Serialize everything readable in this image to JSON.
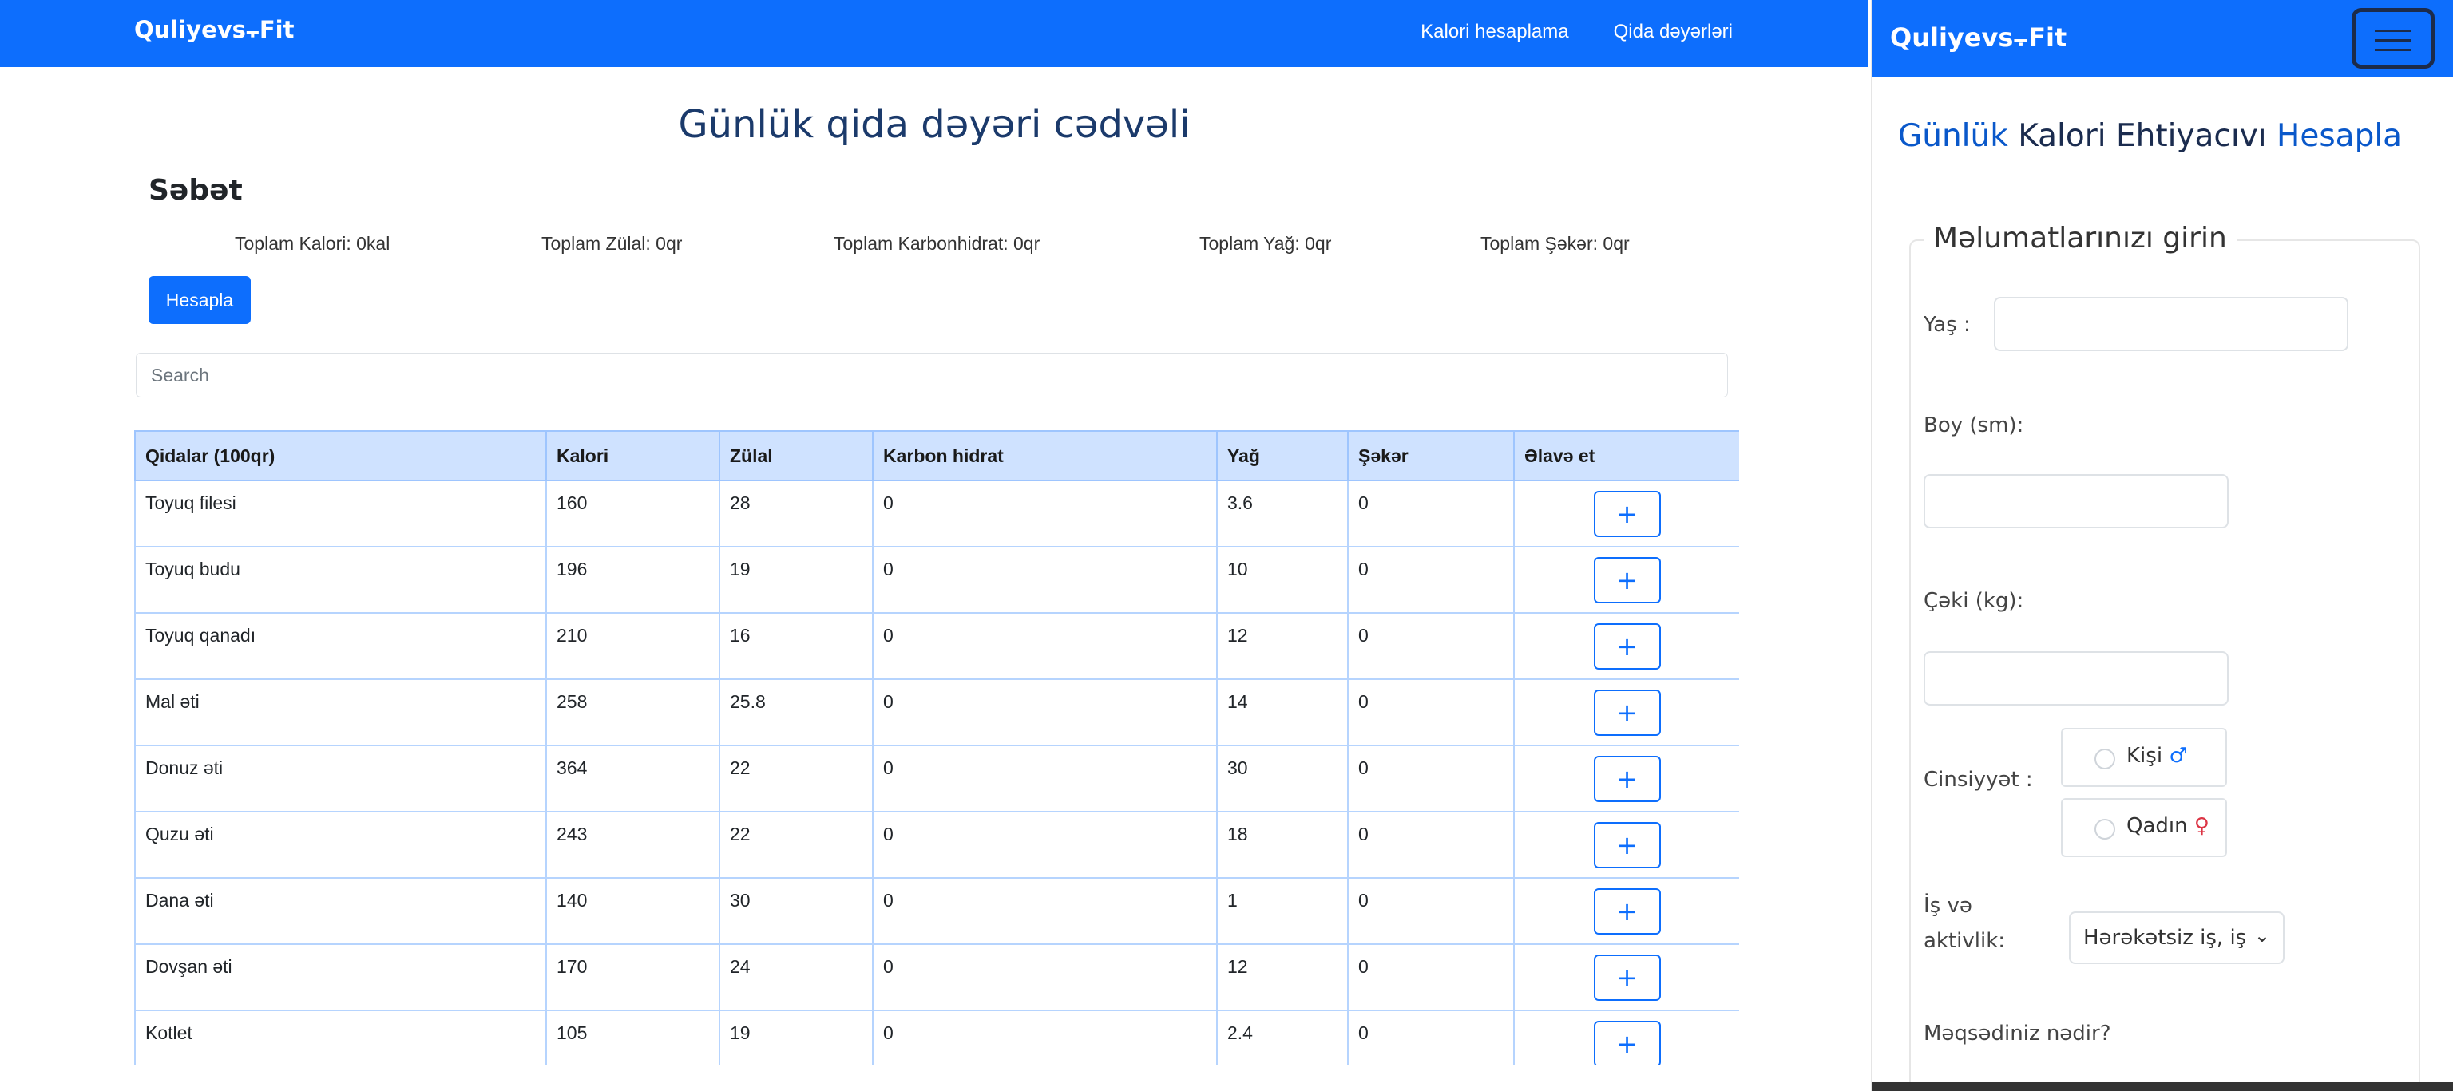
{
  "brand": "Quliyevs⨪Fit",
  "nav_links": [
    "Kalori hesaplama",
    "Qida dəyərləri"
  ],
  "page_title": "Günlük qida dəyəri cədvəli",
  "cart": {
    "title": "Səbət",
    "totals": {
      "calories": "Toplam Kalori: 0kal",
      "protein": "Toplam Zülal: 0qr",
      "carbs": "Toplam Karbonhidrat: 0qr",
      "fat": "Toplam Yağ: 0qr",
      "sugar": "Toplam Şəkər: 0qr"
    },
    "calculate_button": "Hesapla"
  },
  "search": {
    "placeholder": "Search"
  },
  "table": {
    "headers": [
      "Qidalar (100qr)",
      "Kalori",
      "Zülal",
      "Karbon hidrat",
      "Yağ",
      "Şəkər",
      "Əlavə et"
    ],
    "add_symbol": "+",
    "rows": [
      [
        "Toyuq filesi",
        "160",
        "28",
        "0",
        "3.6",
        "0"
      ],
      [
        "Toyuq budu",
        "196",
        "19",
        "0",
        "10",
        "0"
      ],
      [
        "Toyuq qanadı",
        "210",
        "16",
        "0",
        "12",
        "0"
      ],
      [
        "Mal əti",
        "258",
        "25.8",
        "0",
        "14",
        "0"
      ],
      [
        "Donuz əti",
        "364",
        "22",
        "0",
        "30",
        "0"
      ],
      [
        "Quzu əti",
        "243",
        "22",
        "0",
        "18",
        "0"
      ],
      [
        "Dana əti",
        "140",
        "30",
        "0",
        "1",
        "0"
      ],
      [
        "Dovşan əti",
        "170",
        "24",
        "0",
        "12",
        "0"
      ],
      [
        "Kotlet",
        "105",
        "19",
        "0",
        "2.4",
        "0"
      ]
    ]
  },
  "mobile": {
    "brand": "Quliyevs⨪Fit",
    "menu_icon": "hamburger-icon",
    "title_words": [
      "Günlük",
      "Kalori",
      "Ehtiyacıvı",
      "Hesapla"
    ],
    "legend": "Məlumatlarınızı girin",
    "age_label": "Yaş :",
    "height_label": "Boy (sm):",
    "weight_label": "Çəki (kg):",
    "gender_label": "Cinsiyyət :",
    "male": "Kişi",
    "male_symbol": "♂",
    "female": "Qadın",
    "female_symbol": "♀",
    "activity_label_1": "İş və",
    "activity_label_2": "aktivlik:",
    "activity_value": "Hərəkətsiz iş, iş",
    "goal_label": "Məqsədiniz nədir?"
  },
  "colors": {
    "primary": "#0d6efd",
    "table_header": "#cfe2ff",
    "title": "#1b3a6b"
  }
}
